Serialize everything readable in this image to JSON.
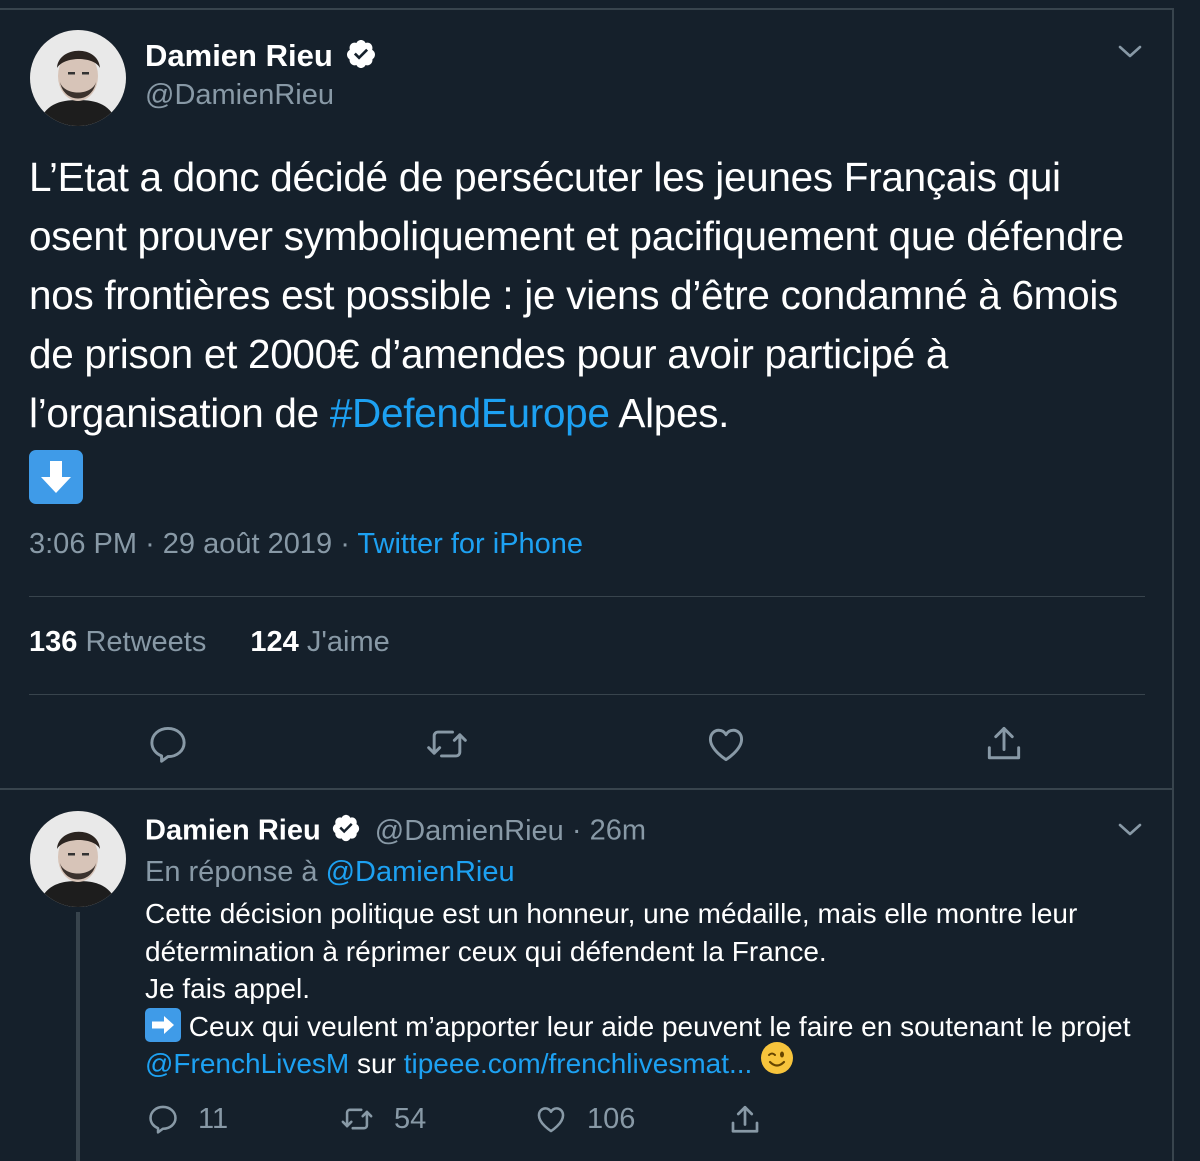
{
  "tweet": {
    "author_name": "Damien Rieu",
    "author_handle": "@DamienRieu",
    "text_before_hashtag": "L’Etat a donc décidé de persécuter les jeunes Français qui osent prouver symboliquement et pacifiquement que défendre nos frontières est possible : je viens d’être condamné à 6mois de prison et 2000€ d’amendes pour avoir participé à l’organisation de ",
    "hashtag": "#DefendEurope",
    "text_after_hashtag": " Alpes.",
    "emoji": "down-arrow-emoji",
    "time": "3:06 PM",
    "date": "29 août 2019",
    "separator": "·",
    "source": "Twitter for iPhone",
    "retweets_count": "136",
    "retweets_label": "Retweets",
    "likes_count": "124",
    "likes_label": "J'aime"
  },
  "reply": {
    "author_name": "Damien Rieu",
    "author_handle": "@DamienRieu",
    "separator": "·",
    "age": "26m",
    "in_reply_prefix": "En réponse à",
    "in_reply_handle": "@DamienRieu",
    "line1": "Cette décision politique est un honneur, une médaille, mais elle montre leur détermination à réprimer ceux qui défendent la France.",
    "line2": "Je fais appel.",
    "line3_emoji": "right-arrow-emoji",
    "line3_text": "Ceux qui veulent m’apporter leur aide peuvent le faire en soutenant le projet ",
    "mention": "@FrenchLivesM",
    "mid_text": " sur ",
    "url": "tipeee.com/frenchlivesmat...",
    "trailing_emoji": "winking-face-emoji",
    "reply_count": "11",
    "retweet_count": "54",
    "like_count": "106"
  },
  "colors": {
    "background": "#15202b",
    "accent": "#1da1f2",
    "muted": "#8899a6",
    "divider": "#38444d"
  }
}
